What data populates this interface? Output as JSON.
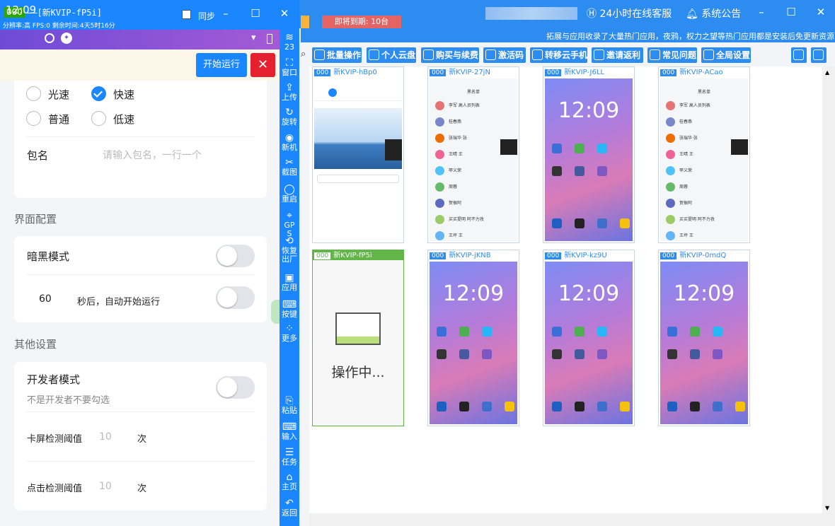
{
  "main": {
    "expire_badge": "即将到期: 10台",
    "customer_service": "24小时在线客服",
    "notice": "系统公告",
    "marquee": "拓展与应用收录了大量热门应用，夜鸦，权力之望等热门应用都是安装后免更新资源",
    "toolbar": [
      {
        "label": "批量操作",
        "icon": "batch-icon"
      },
      {
        "label": "个人云盘",
        "icon": "cloud-icon"
      },
      {
        "label": "购买与续费",
        "icon": "shop-icon"
      },
      {
        "label": "激活码",
        "icon": "code-icon"
      },
      {
        "label": "转移云手机",
        "icon": "transfer-icon"
      },
      {
        "label": "邀请返利",
        "icon": "invite-icon"
      },
      {
        "label": "常见问题",
        "icon": "faq-icon"
      },
      {
        "label": "全局设置",
        "icon": "settings-icon"
      }
    ],
    "cards": [
      {
        "num": "000",
        "name": "新KVIP-hBp0",
        "type": "chat"
      },
      {
        "num": "000",
        "name": "新KVIP-27jN",
        "type": "contacts"
      },
      {
        "num": "000",
        "name": "新KVIP-J6LL",
        "type": "home"
      },
      {
        "num": "000",
        "name": "新KVIP-ACao",
        "type": "contacts"
      },
      {
        "num": "000",
        "name": "新KVIP-fP5i",
        "type": "busy"
      },
      {
        "num": "000",
        "name": "新KVIP-jKNB",
        "type": "home"
      },
      {
        "num": "000",
        "name": "新KVIP-kz9U",
        "type": "home"
      },
      {
        "num": "000",
        "name": "新KVIP-0mdQ",
        "type": "home"
      }
    ],
    "home_clock": "12:09",
    "busy_text": "操作中...",
    "contacts_title": "黑名单",
    "contacts": [
      "李军 高人员列表",
      "桂春燕",
      "张瑞华 张",
      "王晴 王",
      "甲义荣",
      "周蓉",
      "贺振阿",
      "买买提明 阿不力孜",
      "王坪 王"
    ]
  },
  "phone": {
    "id": "000",
    "name": "——[新KVIP-fP5i]",
    "stats": "分辨率:高 FPS:0 剩余时间:4天5时16分",
    "sync_label": "同步",
    "status_time": "12:09",
    "run_label": "开始运行",
    "speed_options": [
      "光速",
      "快速",
      "普通",
      "低速"
    ],
    "package_label": "包名",
    "package_placeholder": "请输入包名，一行一个",
    "ui_section": "界面配置",
    "dark_mode": "暗黑模式",
    "auto_seconds": "60",
    "auto_text": "秒后，自动开始运行",
    "other_section": "其他设置",
    "dev_mode": "开发者模式",
    "dev_hint": "不是开发者不要勾选",
    "stuck_label": "卡屏检测阈值",
    "stuck_value": "10",
    "stuck_unit": "次",
    "click_label": "点击检测阈值",
    "click_value": "10",
    "click_unit": "次"
  },
  "sidebar": [
    {
      "label": "23",
      "glyph": "≋",
      "icon": "wifi-icon"
    },
    {
      "label": "窗口",
      "glyph": "⛶",
      "icon": "window-icon"
    },
    {
      "label": "上传",
      "glyph": "⇪",
      "icon": "upload-icon"
    },
    {
      "label": "旋转",
      "glyph": "↻",
      "icon": "rotate-icon"
    },
    {
      "label": "新机",
      "glyph": "◉",
      "icon": "new-device-icon"
    },
    {
      "label": "截图",
      "glyph": "✂",
      "icon": "screenshot-icon"
    },
    {
      "label": "重启",
      "glyph": "◯",
      "icon": "restart-icon"
    },
    {
      "label": "GPS",
      "glyph": "⌖",
      "icon": "gps-icon"
    },
    {
      "label": "恢复出厂",
      "glyph": "⟲",
      "icon": "reset-icon"
    },
    {
      "label": "应用",
      "glyph": "▣",
      "icon": "app-icon"
    },
    {
      "label": "按键",
      "glyph": "⌨",
      "icon": "keyboard-icon"
    },
    {
      "label": "更多",
      "glyph": "⁘",
      "icon": "more-icon"
    },
    {
      "label": "粘贴",
      "glyph": "⎘",
      "icon": "paste-icon"
    },
    {
      "label": "输入",
      "glyph": "⌨",
      "icon": "input-icon"
    },
    {
      "label": "任务",
      "glyph": "☰",
      "icon": "task-icon"
    },
    {
      "label": "主页",
      "glyph": "⌂",
      "icon": "home-icon"
    },
    {
      "label": "返回",
      "glyph": "↶",
      "icon": "back-icon"
    }
  ]
}
